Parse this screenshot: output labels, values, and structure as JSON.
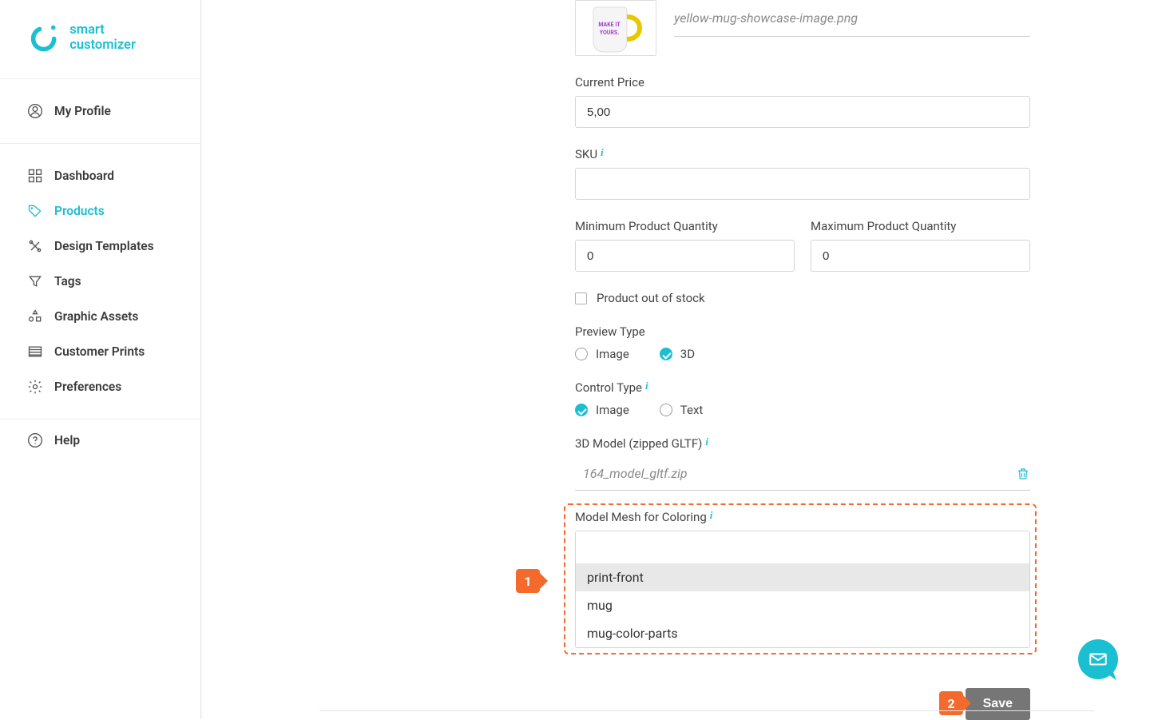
{
  "brand": {
    "name": "smart customizer"
  },
  "sidebar": {
    "profile_label": "My Profile",
    "items": [
      {
        "label": "Dashboard"
      },
      {
        "label": "Products"
      },
      {
        "label": "Design Templates"
      },
      {
        "label": "Tags"
      },
      {
        "label": "Graphic Assets"
      },
      {
        "label": "Customer Prints"
      },
      {
        "label": "Preferences"
      }
    ],
    "help_label": "Help"
  },
  "form": {
    "image_filename": "yellow-mug-showcase-image.png",
    "current_price_label": "Current Price",
    "current_price_value": "5,00",
    "sku_label": "SKU",
    "sku_value": "",
    "min_qty_label": "Minimum Product Quantity",
    "min_qty_value": "0",
    "max_qty_label": "Maximum Product Quantity",
    "max_qty_value": "0",
    "out_of_stock_label": "Product out of stock",
    "preview_type_label": "Preview Type",
    "preview_option_image": "Image",
    "preview_option_3d": "3D",
    "control_type_label": "Control Type",
    "control_option_image": "Image",
    "control_option_text": "Text",
    "model_label": "3D Model (zipped GLTF)",
    "model_filename": "164_model_gltf.zip",
    "mesh_label": "Model Mesh for Coloring",
    "mesh_options": [
      "print-front",
      "mug",
      "mug-color-parts"
    ],
    "save_label": "Save"
  },
  "callouts": {
    "one": "1",
    "two": "2"
  }
}
